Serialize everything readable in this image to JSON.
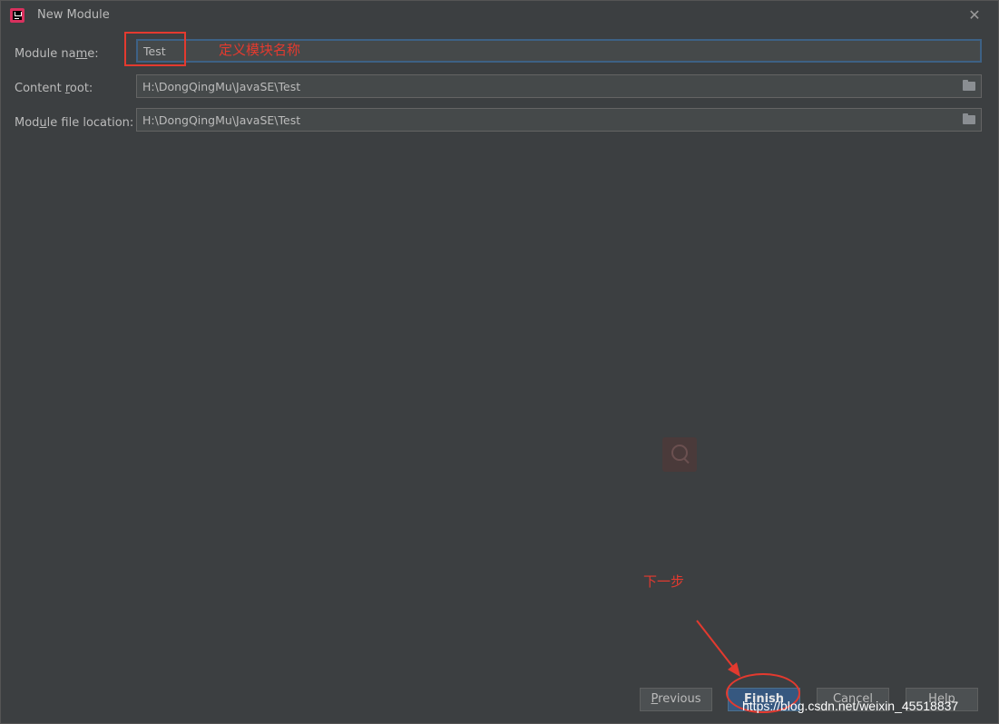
{
  "window": {
    "title": "New Module"
  },
  "form": {
    "module_name": {
      "label_pre": "Module na",
      "label_mn": "m",
      "label_post": "e:",
      "value": "Test"
    },
    "content_root": {
      "label_pre": "Content ",
      "label_mn": "r",
      "label_post": "oot:",
      "value": "H:\\DongQingMu\\JavaSE\\Test"
    },
    "module_file_location": {
      "label_pre": "Mod",
      "label_mn": "u",
      "label_post": "le file location:",
      "value": "H:\\DongQingMu\\JavaSE\\Test"
    }
  },
  "annotations": {
    "define_name": "定义模块名称",
    "next_step": "下一步"
  },
  "buttons": {
    "previous": {
      "mn": "P",
      "rest": "revious"
    },
    "finish": {
      "mn": "F",
      "rest": "inish"
    },
    "cancel": {
      "label": "Cancel"
    },
    "help": {
      "label": "Help"
    }
  },
  "watermark": {
    "url": "https://blog.csdn.net/weixin_45518837"
  },
  "icons": [
    "intellij-app-icon",
    "close-icon",
    "folder-icon",
    "search-icon"
  ],
  "colors": {
    "accent_red": "#e33a2f",
    "primary_button": "#365880",
    "background": "#3c3f41"
  }
}
